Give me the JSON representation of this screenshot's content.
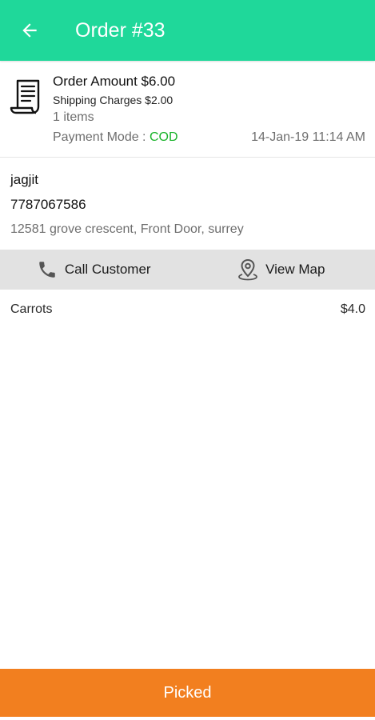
{
  "colors": {
    "appbar": "#1fd89a",
    "accent_cod": "#19b32a",
    "action_bar": "#e2e2e2",
    "primary_button": "#f27f1f"
  },
  "header": {
    "back_icon": "arrow-left-icon",
    "title": "Order #33"
  },
  "order": {
    "icon": "receipt-icon",
    "amount": "Order Amount $6.00",
    "shipping": "Shipping Charges $2.00",
    "items": "1 items",
    "payment_label": "Payment Mode : ",
    "payment_value": "COD",
    "datetime": "14-Jan-19 11:14 AM"
  },
  "customer": {
    "name": "jagjit",
    "phone": "7787067586",
    "address": "12581 grove crescent, Front Door, surrey"
  },
  "actions": {
    "call_icon": "phone-icon",
    "call_label": "Call Customer",
    "map_icon": "map-pin-icon",
    "map_label": "View Map"
  },
  "line_items": [
    {
      "name": "Carrots",
      "price": "$4.0"
    }
  ],
  "footer": {
    "picked_label": "Picked"
  }
}
